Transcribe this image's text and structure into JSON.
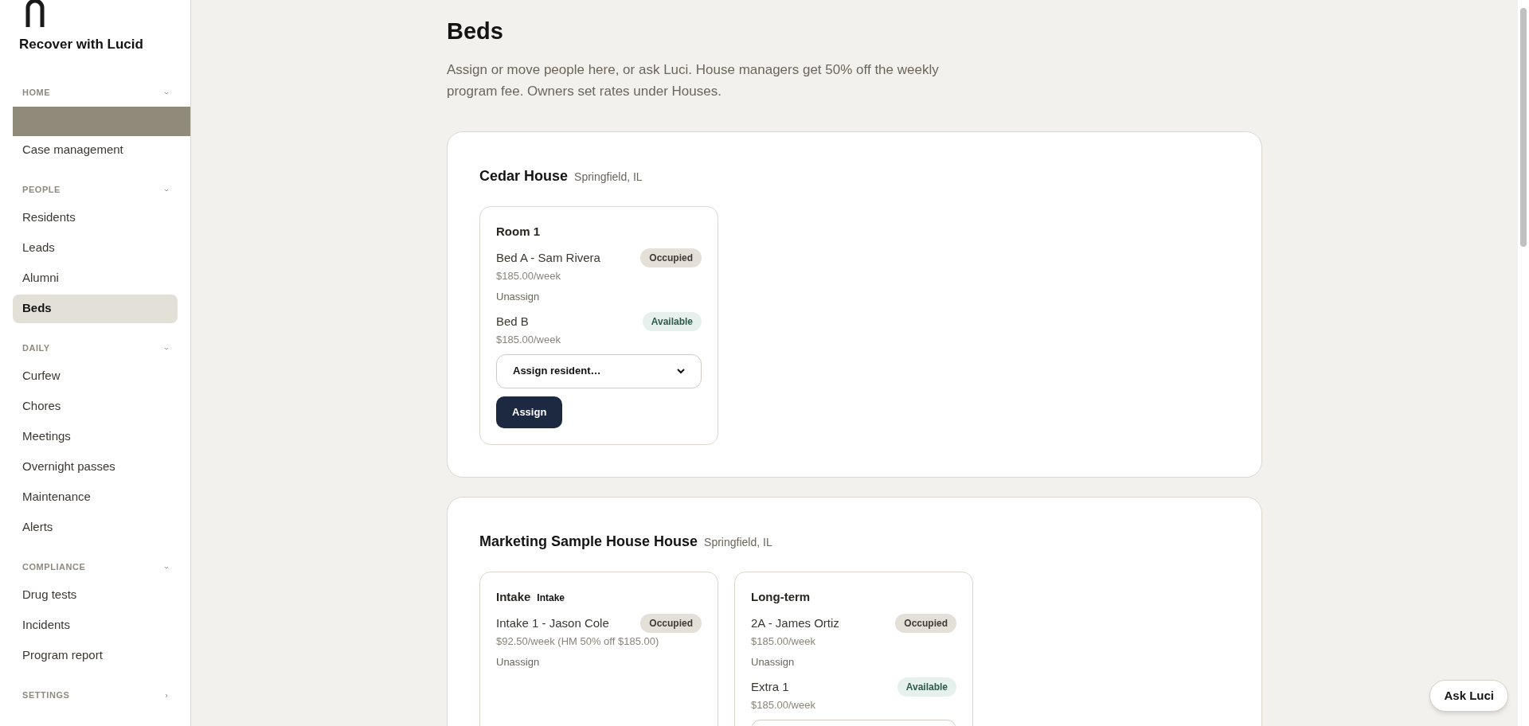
{
  "sidebar": {
    "brand": "Recover with Lucid",
    "sections": [
      {
        "title": "HOME",
        "expanded": true,
        "redacted": true,
        "items": [
          {
            "label": "Case management",
            "selected": false
          }
        ]
      },
      {
        "title": "PEOPLE",
        "expanded": true,
        "items": [
          {
            "label": "Residents",
            "selected": false
          },
          {
            "label": "Leads",
            "selected": false
          },
          {
            "label": "Alumni",
            "selected": false
          },
          {
            "label": "Beds",
            "selected": true
          }
        ]
      },
      {
        "title": "DAILY",
        "expanded": true,
        "items": [
          {
            "label": "Curfew",
            "selected": false
          },
          {
            "label": "Chores",
            "selected": false
          },
          {
            "label": "Meetings",
            "selected": false
          },
          {
            "label": "Overnight passes",
            "selected": false
          },
          {
            "label": "Maintenance",
            "selected": false
          },
          {
            "label": "Alerts",
            "selected": false
          }
        ]
      },
      {
        "title": "COMPLIANCE",
        "expanded": true,
        "items": [
          {
            "label": "Drug tests",
            "selected": false
          },
          {
            "label": "Incidents",
            "selected": false
          },
          {
            "label": "Program report",
            "selected": false
          }
        ]
      },
      {
        "title": "SETTINGS",
        "expanded": false
      }
    ]
  },
  "page": {
    "title": "Beds",
    "description": "Assign or move people here, or ask Luci. House managers get 50% off the weekly program fee. Owners set rates under Houses."
  },
  "houses": [
    {
      "name": "Cedar House",
      "location": "Springfield, IL",
      "rooms": [
        {
          "name": "Room 1",
          "beds": [
            {
              "name": "Bed A - Sam Rivera",
              "status": "Occupied",
              "kind": "occupied",
              "price": "$185.00/week",
              "action": "Unassign"
            },
            {
              "name": "Bed B",
              "status": "Available",
              "kind": "available",
              "price": "$185.00/week",
              "select_placeholder": "Assign resident…",
              "button": "Assign"
            }
          ]
        }
      ]
    },
    {
      "name": "Marketing Sample House House",
      "location": "Springfield, IL",
      "rooms": [
        {
          "name": "Intake",
          "tag": "Intake",
          "beds": [
            {
              "name": "Intake 1 - Jason Cole",
              "status": "Occupied",
              "kind": "occupied",
              "price": "$92.50/week (HM 50% off $185.00)",
              "action": "Unassign"
            }
          ]
        },
        {
          "name": "Long-term",
          "beds": [
            {
              "name": "2A - James Ortiz",
              "status": "Occupied",
              "kind": "occupied",
              "price": "$185.00/week",
              "action": "Unassign"
            },
            {
              "name": "Extra 1",
              "status": "Available",
              "kind": "available",
              "price": "$185.00/week"
            }
          ]
        }
      ]
    }
  ],
  "assistant_button": "Ask Luci"
}
